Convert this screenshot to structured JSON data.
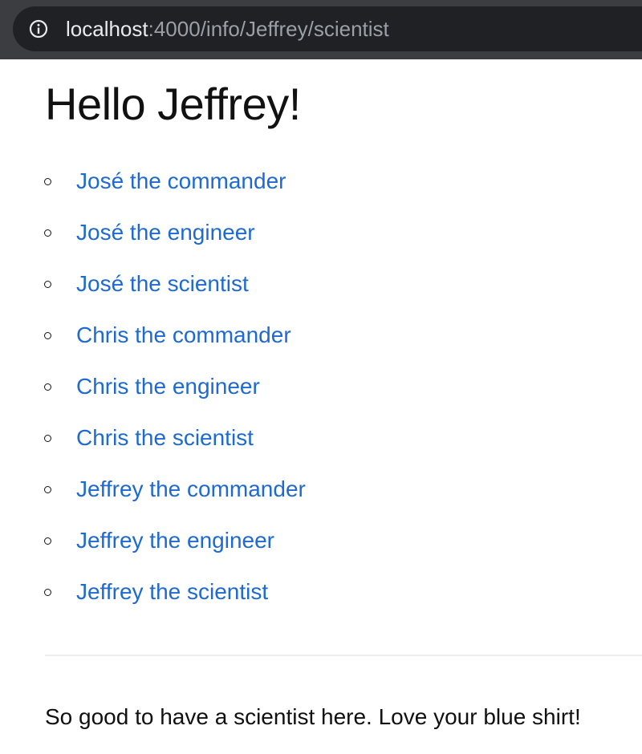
{
  "browser": {
    "url_host": "localhost",
    "url_rest": ":4000/info/Jeffrey/scientist",
    "info_icon": "info-icon"
  },
  "page": {
    "title": "Hello Jeffrey!",
    "links": [
      {
        "label": "José the commander"
      },
      {
        "label": "José the engineer"
      },
      {
        "label": "José the scientist"
      },
      {
        "label": "Chris the commander"
      },
      {
        "label": "Chris the engineer"
      },
      {
        "label": "Chris the scientist"
      },
      {
        "label": "Jeffrey the commander"
      },
      {
        "label": "Jeffrey the engineer"
      },
      {
        "label": "Jeffrey the scientist"
      }
    ],
    "message": "So good to have a scientist here. Love your blue shirt!"
  },
  "colors": {
    "link": "#1e6ad3",
    "text": "#111111",
    "chrome_bg": "#3b3d40",
    "urlbar_bg": "#202124"
  }
}
